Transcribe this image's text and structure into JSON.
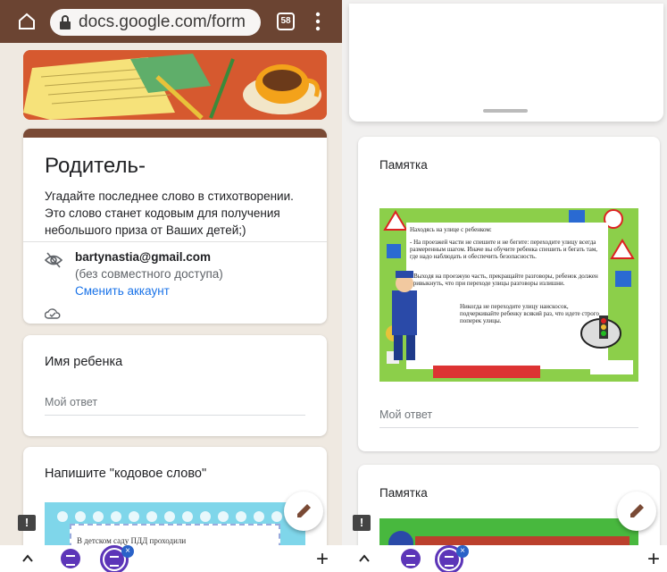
{
  "left": {
    "url": "docs.google.com/form",
    "tab_count": "58",
    "form": {
      "title": "Родитель-",
      "description": "Угадайте последнее слово в стихотворении. Это слово станет кодовым для получения небольшого приза от Ваших детей;)",
      "email": "bartynastia@gmail.com",
      "sharing": "(без совместного доступа)",
      "switch_account": "Сменить аккаунт"
    },
    "questions": [
      {
        "title": "Имя ребенка",
        "answer_placeholder": "Мой ответ"
      },
      {
        "title": "Напишите \"кодовое слово\"",
        "image_text": "В детском саду ПДД проходили"
      }
    ]
  },
  "right": {
    "sections": [
      {
        "title": "Памятка",
        "poster_text": [
          "Находясь на улице с ребенком:",
          "- На проезжей части не спешите и не бегите: переходите улицу всегда размеренным шагом. Иначе вы обучите ребенка спешить и бегать там, где надо наблюдать и обеспечить безопасность.",
          "- Выходя на проезжую часть, прекращайте разговоры, ребенок должен привыкнуть, что при переходе улицы разговоры излишни.",
          "Никогда не переходите улицу наискосок, подчеркивайте ребенку всякий раз, что идете строго поперек улицы."
        ],
        "answer_placeholder": "Мой ответ"
      },
      {
        "title": "Памятка"
      }
    ]
  },
  "colors": {
    "theme_bar": "#6b4432",
    "title_accent": "#7a4a35",
    "link": "#1a73e8",
    "form_icon": "#5c35b8"
  }
}
